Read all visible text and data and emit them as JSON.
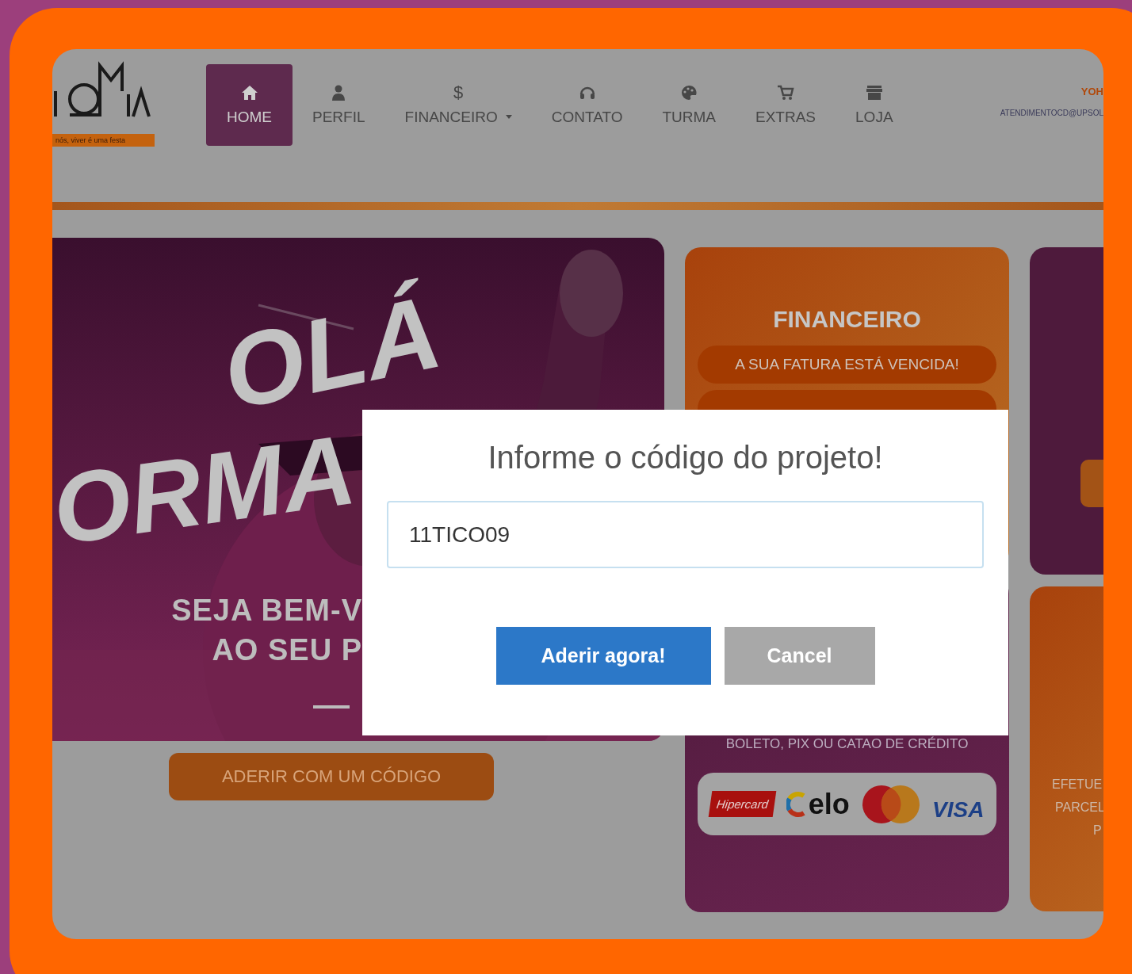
{
  "logo": {
    "tagline": "nós, viver é uma festa"
  },
  "nav": [
    {
      "label": "HOME",
      "kind": "home",
      "selected": true,
      "dropdown": false
    },
    {
      "label": "PERFIL",
      "kind": "user",
      "selected": false,
      "dropdown": false
    },
    {
      "label": "FINANCEIRO",
      "symbol": "$",
      "selected": false,
      "dropdown": true
    },
    {
      "label": "CONTATO",
      "kind": "headset",
      "selected": false,
      "dropdown": false
    },
    {
      "label": "TURMA",
      "kind": "palette",
      "selected": false,
      "dropdown": false
    },
    {
      "label": "EXTRAS",
      "kind": "cart",
      "selected": false,
      "dropdown": false
    },
    {
      "label": "LOJA",
      "kind": "store",
      "selected": false,
      "dropdown": false
    }
  ],
  "account": {
    "name": "YOH",
    "email": "ATENDIMENTOCD@UPSOL"
  },
  "hero": {
    "greeting": "OLÁ",
    "greeting_2": "ORMA",
    "welcome": [
      "SEJA BEM-V",
      "AO SEU P"
    ]
  },
  "join_button": "ADERIR COM UM CÓDIGO",
  "finance_card": {
    "title": "FINANCEIRO",
    "alert": "A SUA FATURA ESTÁ VENCIDA!"
  },
  "payment_card": {
    "methods": "BOLETO, PIX OU CATAO DE CRÉDITO",
    "brands": [
      {
        "kind": "hipercard",
        "label": "Hipercard"
      },
      {
        "kind": "elo",
        "label": "elo"
      },
      {
        "kind": "mastercard"
      },
      {
        "kind": "visa",
        "label": "VISA"
      }
    ]
  },
  "side_card": {
    "lines": [
      "EFETUE",
      "PARCEL",
      "P"
    ]
  },
  "modal": {
    "title": "Informe o código do projeto!",
    "value": "11TICO09",
    "confirm": "Aderir agora!",
    "cancel": "Cancel"
  }
}
